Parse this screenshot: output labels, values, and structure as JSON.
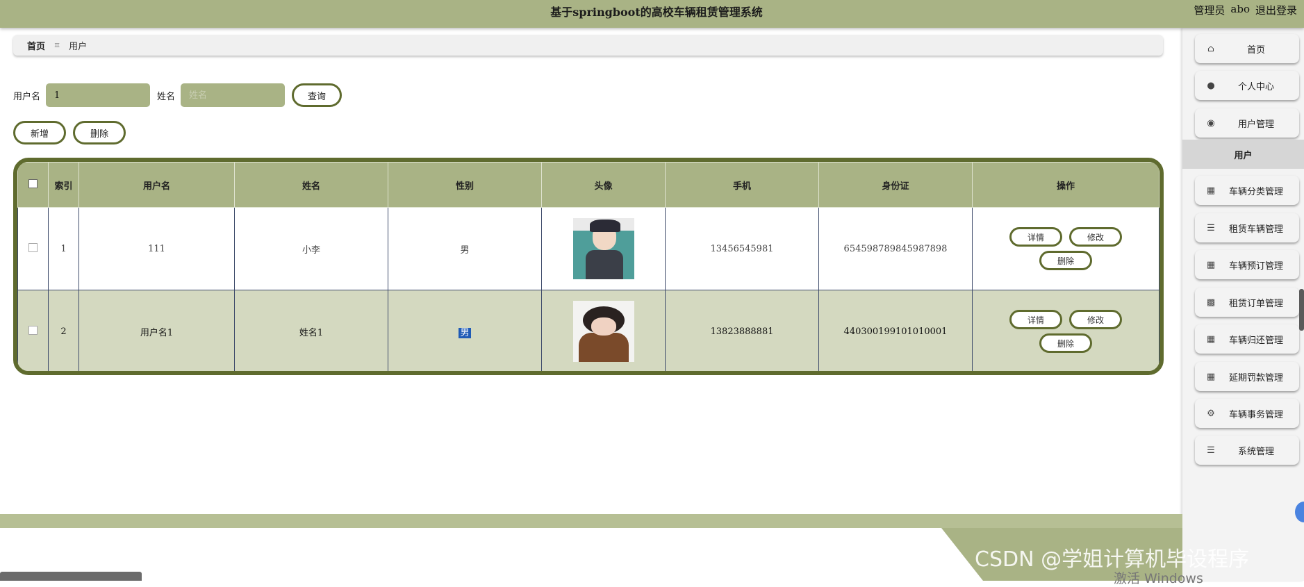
{
  "header": {
    "title": "基于springboot的高校车辆租赁管理系统",
    "role": "管理员",
    "username": "abo",
    "logout": "退出登录"
  },
  "breadcrumb": {
    "home": "首页",
    "separator": "ㅍ",
    "current": "用户"
  },
  "search": {
    "username_label": "用户名",
    "username_value": "1",
    "name_label": "姓名",
    "name_placeholder": "姓名",
    "query_button": "查询"
  },
  "actions": {
    "add": "新增",
    "delete": "删除"
  },
  "table": {
    "headers": [
      "索引",
      "用户名",
      "姓名",
      "性别",
      "头像",
      "手机",
      "身份证",
      "操作"
    ],
    "rows": [
      {
        "index": "1",
        "username": "111",
        "name": "小李",
        "gender": "男",
        "phone": "13456545981",
        "id_card": "654598789845987898"
      },
      {
        "index": "2",
        "username": "用户名1",
        "name": "姓名1",
        "gender": "男",
        "phone": "13823888881",
        "id_card": "440300199101010001"
      }
    ],
    "op_labels": {
      "detail": "详情",
      "edit": "修改",
      "delete": "删除"
    }
  },
  "sidebar": {
    "items": [
      {
        "label": "首页",
        "icon": "home-icon"
      },
      {
        "label": "个人中心",
        "icon": "user-icon"
      },
      {
        "label": "用户管理",
        "icon": "pin-icon"
      },
      {
        "label": "用户",
        "icon": ""
      },
      {
        "label": "车辆分类管理",
        "icon": "grid-icon"
      },
      {
        "label": "租赁车辆管理",
        "icon": "list-icon"
      },
      {
        "label": "车辆预订管理",
        "icon": "grid-icon"
      },
      {
        "label": "租赁订单管理",
        "icon": "cup-icon"
      },
      {
        "label": "车辆归还管理",
        "icon": "grid-icon"
      },
      {
        "label": "延期罚款管理",
        "icon": "grid-icon"
      },
      {
        "label": "车辆事务管理",
        "icon": "sliders-icon"
      },
      {
        "label": "系统管理",
        "icon": "list-icon"
      }
    ]
  },
  "overlay": {
    "watermark": "CSDN @学姐计算机毕设程序",
    "windows": "激活 Windows"
  },
  "colors": {
    "accent": "#a9b385",
    "border": "#5f6b2e",
    "row_alt": "#d4d9c0"
  }
}
